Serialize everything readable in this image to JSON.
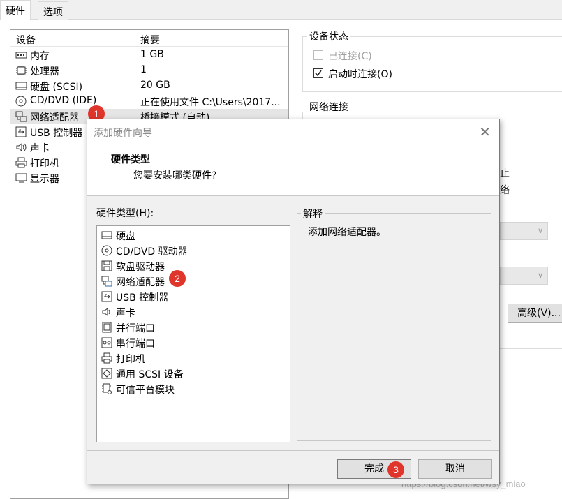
{
  "tabs": [
    "硬件",
    "选项"
  ],
  "device_list": {
    "headers": [
      "设备",
      "摘要"
    ],
    "rows": [
      {
        "icon": "memory-icon",
        "name": "内存",
        "summary": "1 GB"
      },
      {
        "icon": "processor-icon",
        "name": "处理器",
        "summary": "1"
      },
      {
        "icon": "hard-disk-icon",
        "name": "硬盘 (SCSI)",
        "summary": "20 GB"
      },
      {
        "icon": "cd-dvd-icon",
        "name": "CD/DVD (IDE)",
        "summary": "正在使用文件 C:\\Users\\2017..."
      },
      {
        "icon": "network-adapter-icon",
        "name": "网络适配器",
        "summary": "桥接模式 (自动)"
      },
      {
        "icon": "usb-controller-icon",
        "name": "USB 控制器",
        "summary": ""
      },
      {
        "icon": "sound-card-icon",
        "name": "声卡",
        "summary": ""
      },
      {
        "icon": "printer-icon",
        "name": "打印机",
        "summary": ""
      },
      {
        "icon": "display-icon",
        "name": "显示器",
        "summary": ""
      }
    ]
  },
  "device_status": {
    "title": "设备状态",
    "connected": "已连接(C)",
    "connect_at_power_on": "启动时连接(O)"
  },
  "network": {
    "title": "网络连接",
    "partial_1": "止",
    "partial_2": "络",
    "advanced_button": "高级(V)..."
  },
  "dialog": {
    "title": "添加硬件向导",
    "heading": "硬件类型",
    "subheading": "您要安装哪类硬件?",
    "list_label": "硬件类型(H):",
    "items": [
      {
        "icon": "hard-disk-icon",
        "name": "硬盘"
      },
      {
        "icon": "cd-dvd-icon",
        "name": "CD/DVD 驱动器"
      },
      {
        "icon": "floppy-icon",
        "name": "软盘驱动器"
      },
      {
        "icon": "network-adapter-icon",
        "name": "网络适配器"
      },
      {
        "icon": "usb-controller-icon",
        "name": "USB 控制器"
      },
      {
        "icon": "sound-card-icon",
        "name": "声卡"
      },
      {
        "icon": "parallel-port-icon",
        "name": "并行端口"
      },
      {
        "icon": "serial-port-icon",
        "name": "串行端口"
      },
      {
        "icon": "printer-icon",
        "name": "打印机"
      },
      {
        "icon": "scsi-device-icon",
        "name": "通用 SCSI 设备"
      },
      {
        "icon": "tpm-icon",
        "name": "可信平台模块"
      }
    ],
    "explanation_title": "解释",
    "explanation": "添加网络适配器。",
    "finish_button": "完成",
    "cancel_button": "取消"
  },
  "annotations": [
    "1",
    "2",
    "3"
  ],
  "watermark": "https://blog.csdn.net/wsy_miao",
  "colors": {
    "badge": "#e0352b",
    "selection": "#e5e5e5"
  }
}
